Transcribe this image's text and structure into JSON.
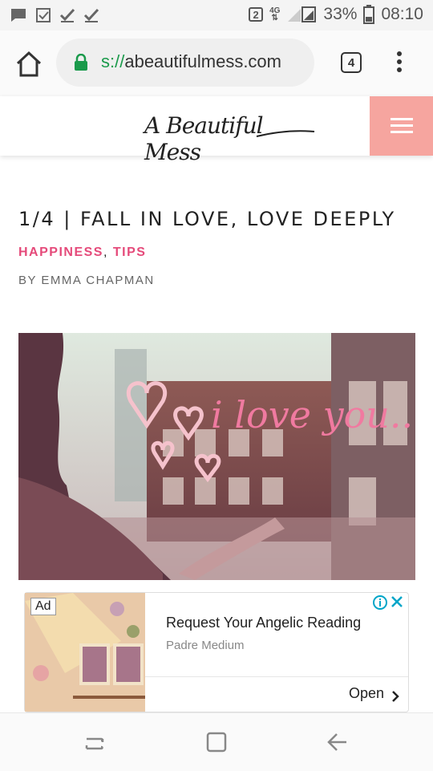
{
  "status_bar": {
    "sim_badge": "2",
    "network": "4G",
    "battery": "33%",
    "time": "08:10"
  },
  "browser": {
    "url_scheme": "s://",
    "url_host": "abeautifulmess.com",
    "tab_count": "4"
  },
  "site": {
    "logo_text": "A Beautiful Mess"
  },
  "article": {
    "title": "1/4 | FALL IN LOVE, LOVE DEEPLY",
    "categories": [
      "HAPPINESS",
      "TIPS"
    ],
    "category_separator": ",",
    "byline": "BY EMMA CHAPMAN"
  },
  "hero": {
    "window_text": "i love you..."
  },
  "ad": {
    "badge": "Ad",
    "title": "Request Your Angelic Reading",
    "advertiser": "Padre Medium",
    "cta": "Open"
  },
  "colors": {
    "accent_pink": "#e54a7a",
    "menu_button": "#f6a59f",
    "lock_green": "#1a9a4b",
    "ad_icon_blue": "#00a5c8"
  }
}
